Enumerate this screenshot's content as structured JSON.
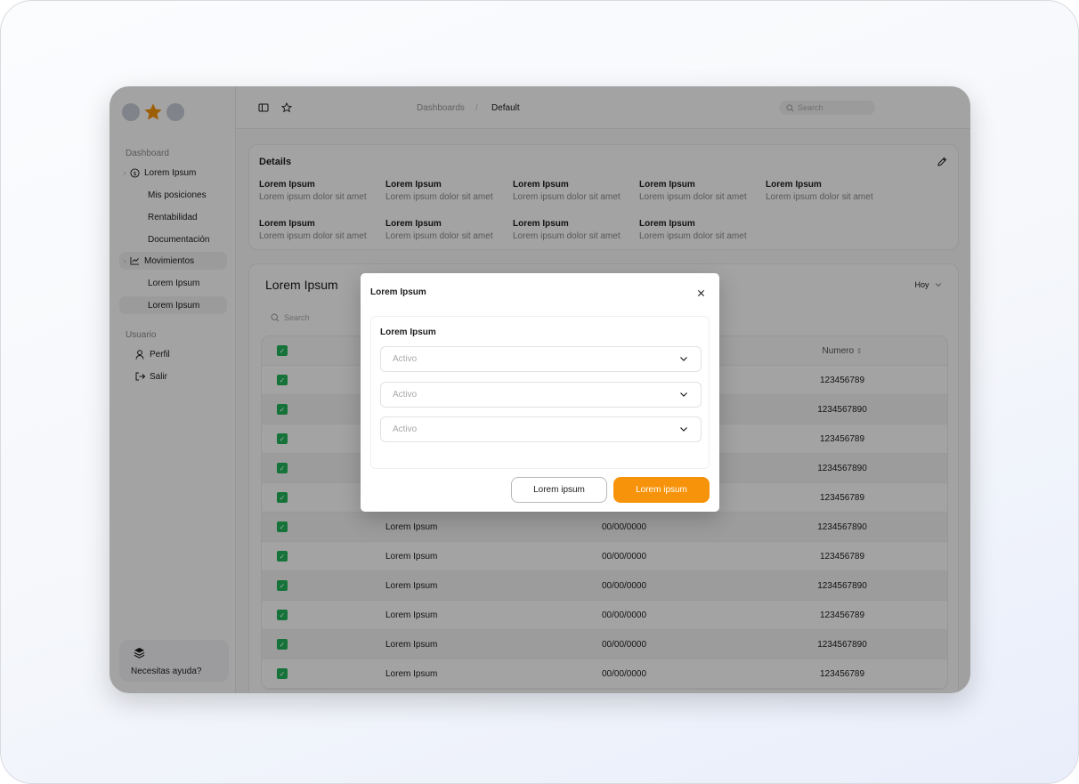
{
  "breadcrumb": {
    "parent": "Dashboards",
    "separator": "/",
    "current": "Default"
  },
  "topbar": {
    "search_placeholder": "Search"
  },
  "sidebar": {
    "section_dashboard": "Dashboard",
    "items": [
      {
        "label": "Lorem Ipsum"
      },
      {
        "label": "Mis posiciones"
      },
      {
        "label": "Rentabilidad"
      },
      {
        "label": "Documentación"
      },
      {
        "label": "Movimientos"
      },
      {
        "label": "Lorem Ipsum"
      },
      {
        "label": "Lorem Ipsum"
      }
    ],
    "section_user": "Usuario",
    "user_items": [
      {
        "label": "Perfil"
      },
      {
        "label": "Salir"
      }
    ],
    "help": "Necesitas ayuda?"
  },
  "details": {
    "title": "Details",
    "cells": [
      {
        "k": "Lorem Ipsum",
        "v": "Lorem ipsum dolor sit amet"
      },
      {
        "k": "Lorem Ipsum",
        "v": "Lorem ipsum dolor sit amet"
      },
      {
        "k": "Lorem Ipsum",
        "v": "Lorem ipsum dolor sit amet"
      },
      {
        "k": "Lorem Ipsum",
        "v": "Lorem ipsum dolor sit amet"
      },
      {
        "k": "Lorem Ipsum",
        "v": "Lorem ipsum dolor sit amet"
      },
      {
        "k": "Lorem Ipsum",
        "v": "Lorem ipsum dolor sit amet"
      },
      {
        "k": "Lorem Ipsum",
        "v": "Lorem ipsum dolor sit amet"
      },
      {
        "k": "Lorem Ipsum",
        "v": "Lorem ipsum dolor sit amet"
      },
      {
        "k": "Lorem Ipsum",
        "v": "Lorem ipsum dolor sit amet"
      }
    ]
  },
  "table_card": {
    "title": "Lorem Ipsum",
    "period": "Hoy",
    "search_placeholder": "Search",
    "column_numero": "Numero",
    "rows": [
      {
        "name": "",
        "date": "",
        "num": "123456789"
      },
      {
        "name": "",
        "date": "",
        "num": "1234567890"
      },
      {
        "name": "",
        "date": "",
        "num": "123456789"
      },
      {
        "name": "",
        "date": "",
        "num": "1234567890"
      },
      {
        "name": "",
        "date": "",
        "num": "123456789"
      },
      {
        "name": "Lorem Ipsum",
        "date": "00/00/0000",
        "num": "1234567890"
      },
      {
        "name": "Lorem Ipsum",
        "date": "00/00/0000",
        "num": "123456789"
      },
      {
        "name": "Lorem Ipsum",
        "date": "00/00/0000",
        "num": "1234567890"
      },
      {
        "name": "Lorem Ipsum",
        "date": "00/00/0000",
        "num": "123456789"
      },
      {
        "name": "Lorem Ipsum",
        "date": "00/00/0000",
        "num": "1234567890"
      },
      {
        "name": "Lorem Ipsum",
        "date": "00/00/0000",
        "num": "123456789"
      }
    ]
  },
  "modal": {
    "title": "Lorem Ipsum",
    "section_title": "Lorem Ipsum",
    "selects": [
      {
        "value": "Activo"
      },
      {
        "value": "Activo"
      },
      {
        "value": "Activo"
      }
    ],
    "cancel_label": "Lorem ipsum",
    "confirm_label": "Lorem ipsum"
  },
  "colors": {
    "accent": "#f7930a",
    "check": "#22b45c",
    "overlay": "rgba(0,0,0,0.36)"
  }
}
